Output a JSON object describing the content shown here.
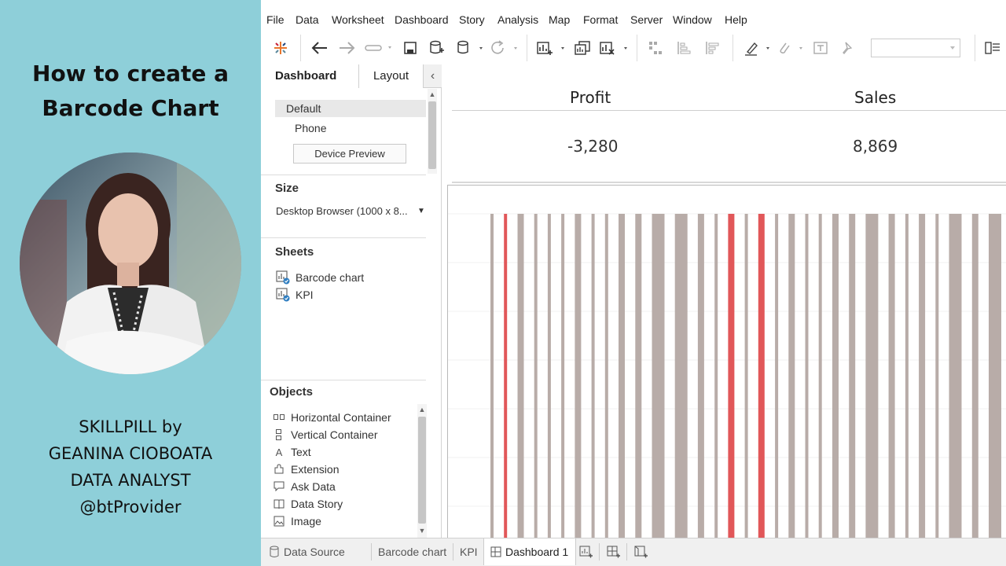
{
  "promo": {
    "title_line1": "How to create a",
    "title_line2": "Barcode Chart",
    "credit_line1": "SKILLPILL by",
    "credit_line2": "GEANINA CIOBOATA",
    "credit_line3": "DATA ANALYST",
    "credit_line4": "@btProvider",
    "background": "#8ecfd9"
  },
  "menu": [
    "File",
    "Data",
    "Worksheet",
    "Dashboard",
    "Story",
    "Analysis",
    "Map",
    "Format",
    "Server",
    "Window",
    "Help"
  ],
  "sidepane": {
    "tab_dashboard": "Dashboard",
    "tab_layout": "Layout",
    "collapse_glyph": "‹",
    "device_default": "Default",
    "device_phone": "Phone",
    "device_preview_label": "Device Preview",
    "size_title": "Size",
    "size_value": "Desktop Browser (1000 x 8...",
    "sheets_title": "Sheets",
    "sheets": [
      "Barcode chart",
      "KPI"
    ],
    "objects_title": "Objects",
    "objects": [
      {
        "label": "Horizontal Container",
        "icon": "horizontal-container-icon"
      },
      {
        "label": "Vertical Container",
        "icon": "vertical-container-icon"
      },
      {
        "label": "Text",
        "icon": "text-icon"
      },
      {
        "label": "Extension",
        "icon": "extension-icon"
      },
      {
        "label": "Ask Data",
        "icon": "ask-data-icon"
      },
      {
        "label": "Data Story",
        "icon": "data-story-icon"
      },
      {
        "label": "Image",
        "icon": "image-icon"
      }
    ]
  },
  "kpi": {
    "profit_label": "Profit",
    "profit_value": "-3,280",
    "sales_label": "Sales",
    "sales_value": "8,869"
  },
  "barcode": {
    "bars": [
      {
        "w": "thin",
        "c": "grey"
      },
      {
        "w": "thin",
        "c": "red"
      },
      {
        "w": "medium",
        "c": "grey"
      },
      {
        "w": "thin",
        "c": "grey"
      },
      {
        "w": "thin",
        "c": "grey"
      },
      {
        "w": "thin",
        "c": "grey"
      },
      {
        "w": "medium",
        "c": "grey"
      },
      {
        "w": "thin",
        "c": "grey"
      },
      {
        "w": "thin",
        "c": "grey"
      },
      {
        "w": "medium",
        "c": "grey"
      },
      {
        "w": "medium",
        "c": "grey"
      },
      {
        "w": "wide",
        "c": "grey"
      },
      {
        "w": "wide",
        "c": "grey"
      },
      {
        "w": "medium",
        "c": "grey"
      },
      {
        "w": "thin",
        "c": "grey"
      },
      {
        "w": "medium",
        "c": "red"
      },
      {
        "w": "thin",
        "c": "grey"
      },
      {
        "w": "medium",
        "c": "red"
      },
      {
        "w": "thin",
        "c": "grey"
      },
      {
        "w": "medium",
        "c": "grey"
      },
      {
        "w": "thin",
        "c": "grey"
      },
      {
        "w": "thin",
        "c": "grey"
      },
      {
        "w": "medium",
        "c": "grey"
      },
      {
        "w": "medium",
        "c": "grey"
      },
      {
        "w": "wide",
        "c": "grey"
      },
      {
        "w": "medium",
        "c": "grey"
      },
      {
        "w": "thin",
        "c": "grey"
      },
      {
        "w": "medium",
        "c": "grey"
      },
      {
        "w": "thin",
        "c": "grey"
      },
      {
        "w": "wide",
        "c": "grey"
      },
      {
        "w": "medium",
        "c": "grey"
      },
      {
        "w": "wide",
        "c": "grey"
      }
    ],
    "colors": {
      "grey": "#b8aca8",
      "red": "#e15759"
    }
  },
  "bottom_tabs": {
    "data_source": "Data Source",
    "barcode_chart": "Barcode chart",
    "kpi": "KPI",
    "dashboard1": "Dashboard 1"
  }
}
